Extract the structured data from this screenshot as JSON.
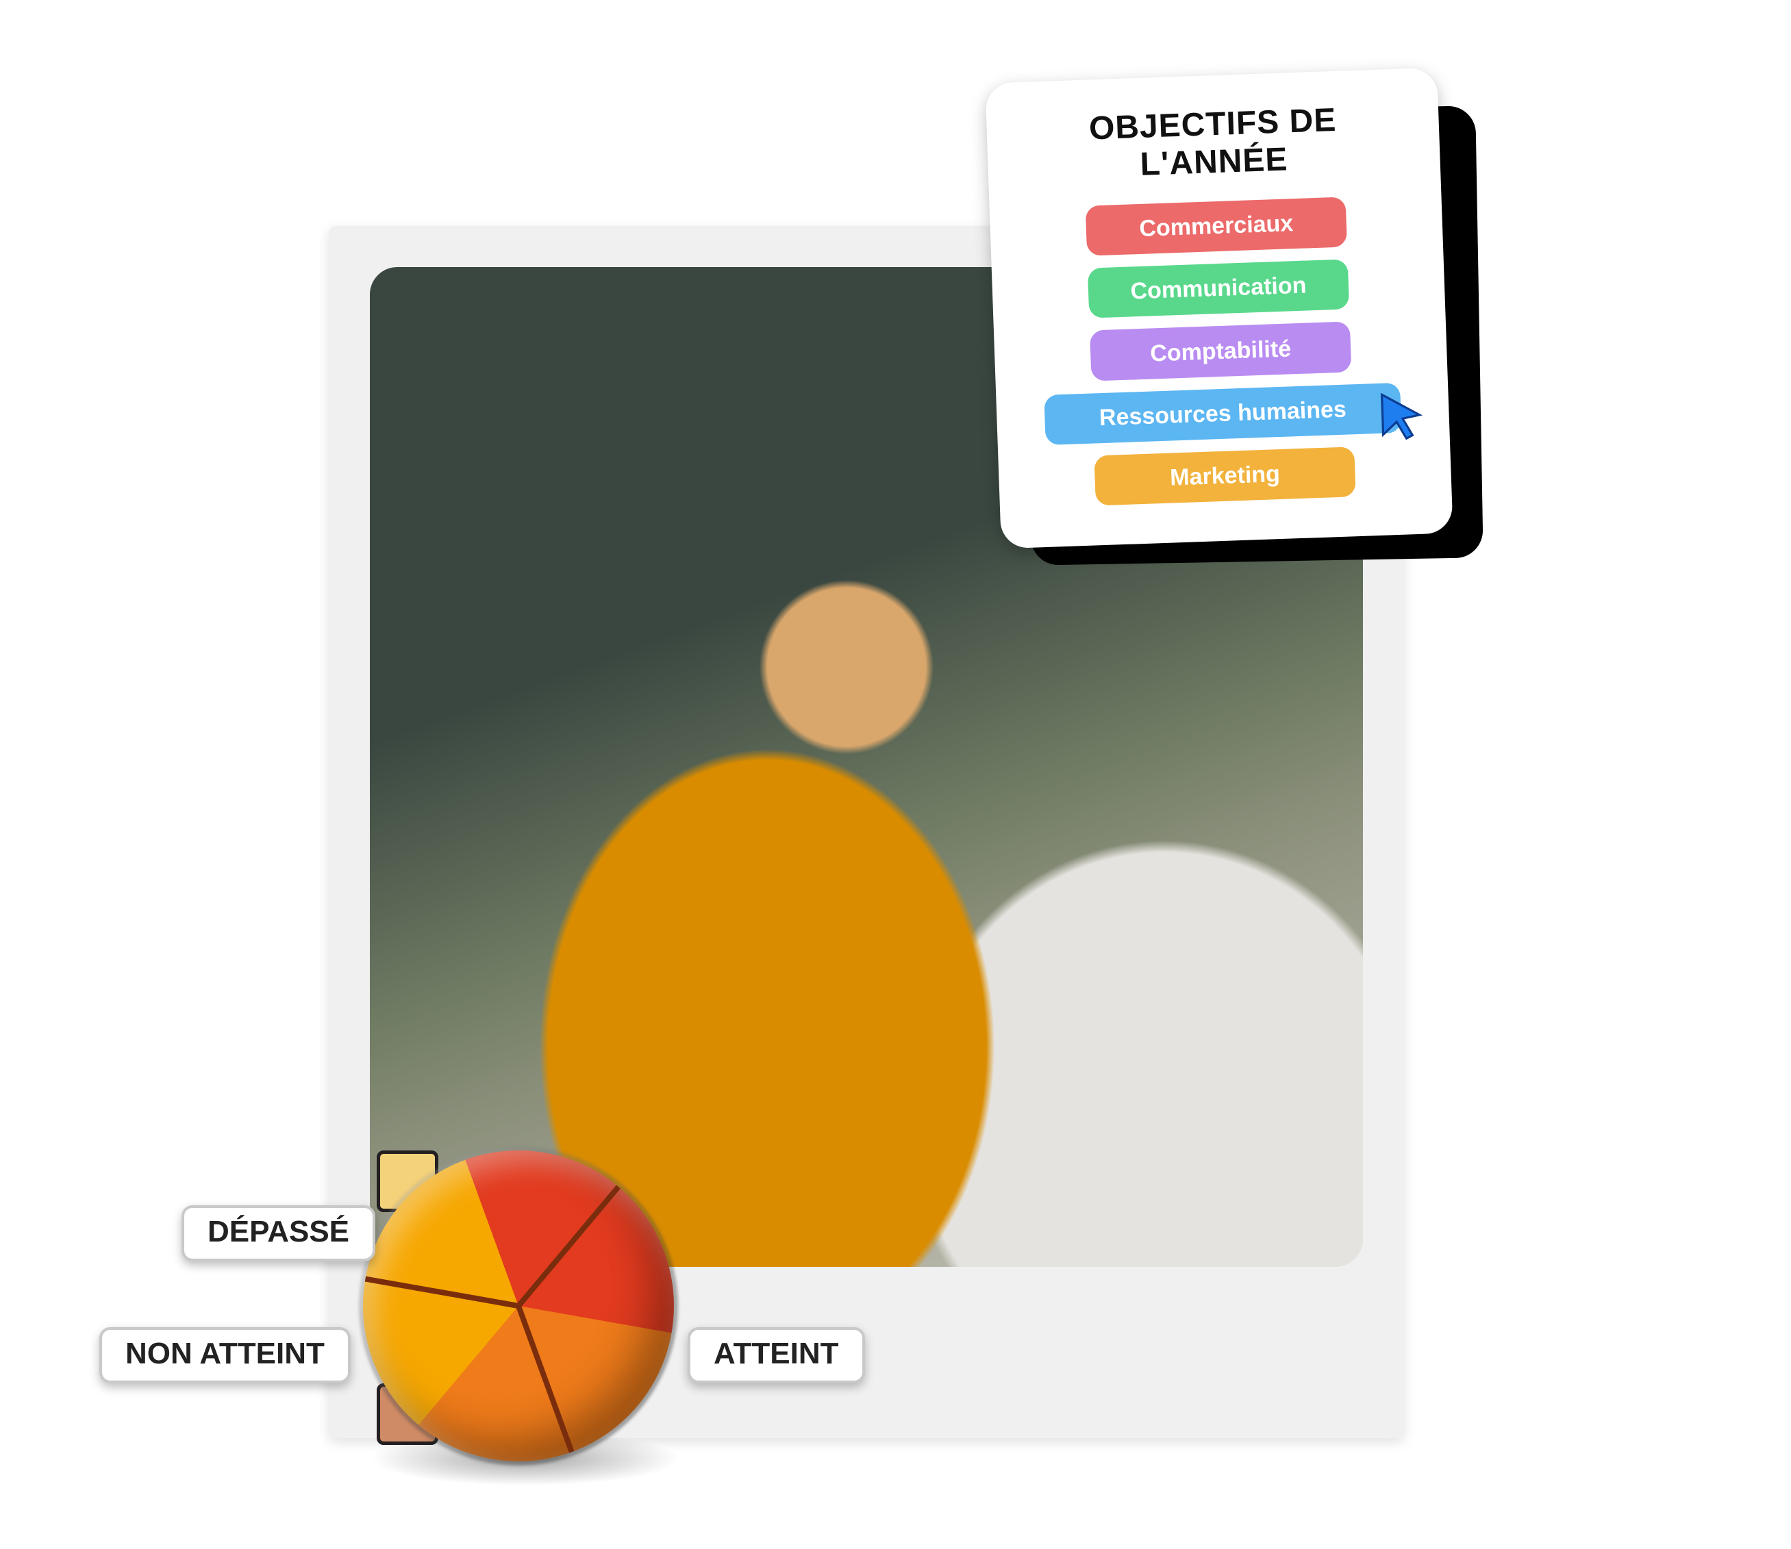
{
  "objectives": {
    "title": "OBJECTIFS DE L'ANNÉE",
    "items": [
      {
        "label": "Commerciaux",
        "color": "#ec6a6a",
        "wide": false
      },
      {
        "label": "Communication",
        "color": "#59d88c",
        "wide": false
      },
      {
        "label": "Comptabilité",
        "color": "#b98cf2",
        "wide": false
      },
      {
        "label": "Ressources humaines",
        "color": "#5cb6f2",
        "wide": true
      },
      {
        "label": "Marketing",
        "color": "#f2b23c",
        "wide": false
      }
    ]
  },
  "pie": {
    "labels": {
      "exceeded": "DÉPASSÉ",
      "not_reached": "NON ATTEINT",
      "reached": "ATTEINT"
    }
  },
  "chart_data": {
    "type": "pie",
    "title": "",
    "series": [
      {
        "name": "DÉPASSÉ",
        "value": 33.3,
        "color": "#f6a700"
      },
      {
        "name": "ATTEINT",
        "value": 33.3,
        "color": "#e23b1f"
      },
      {
        "name": "NON ATTEINT",
        "value": 33.3,
        "color": "#ef7b1a"
      }
    ]
  }
}
